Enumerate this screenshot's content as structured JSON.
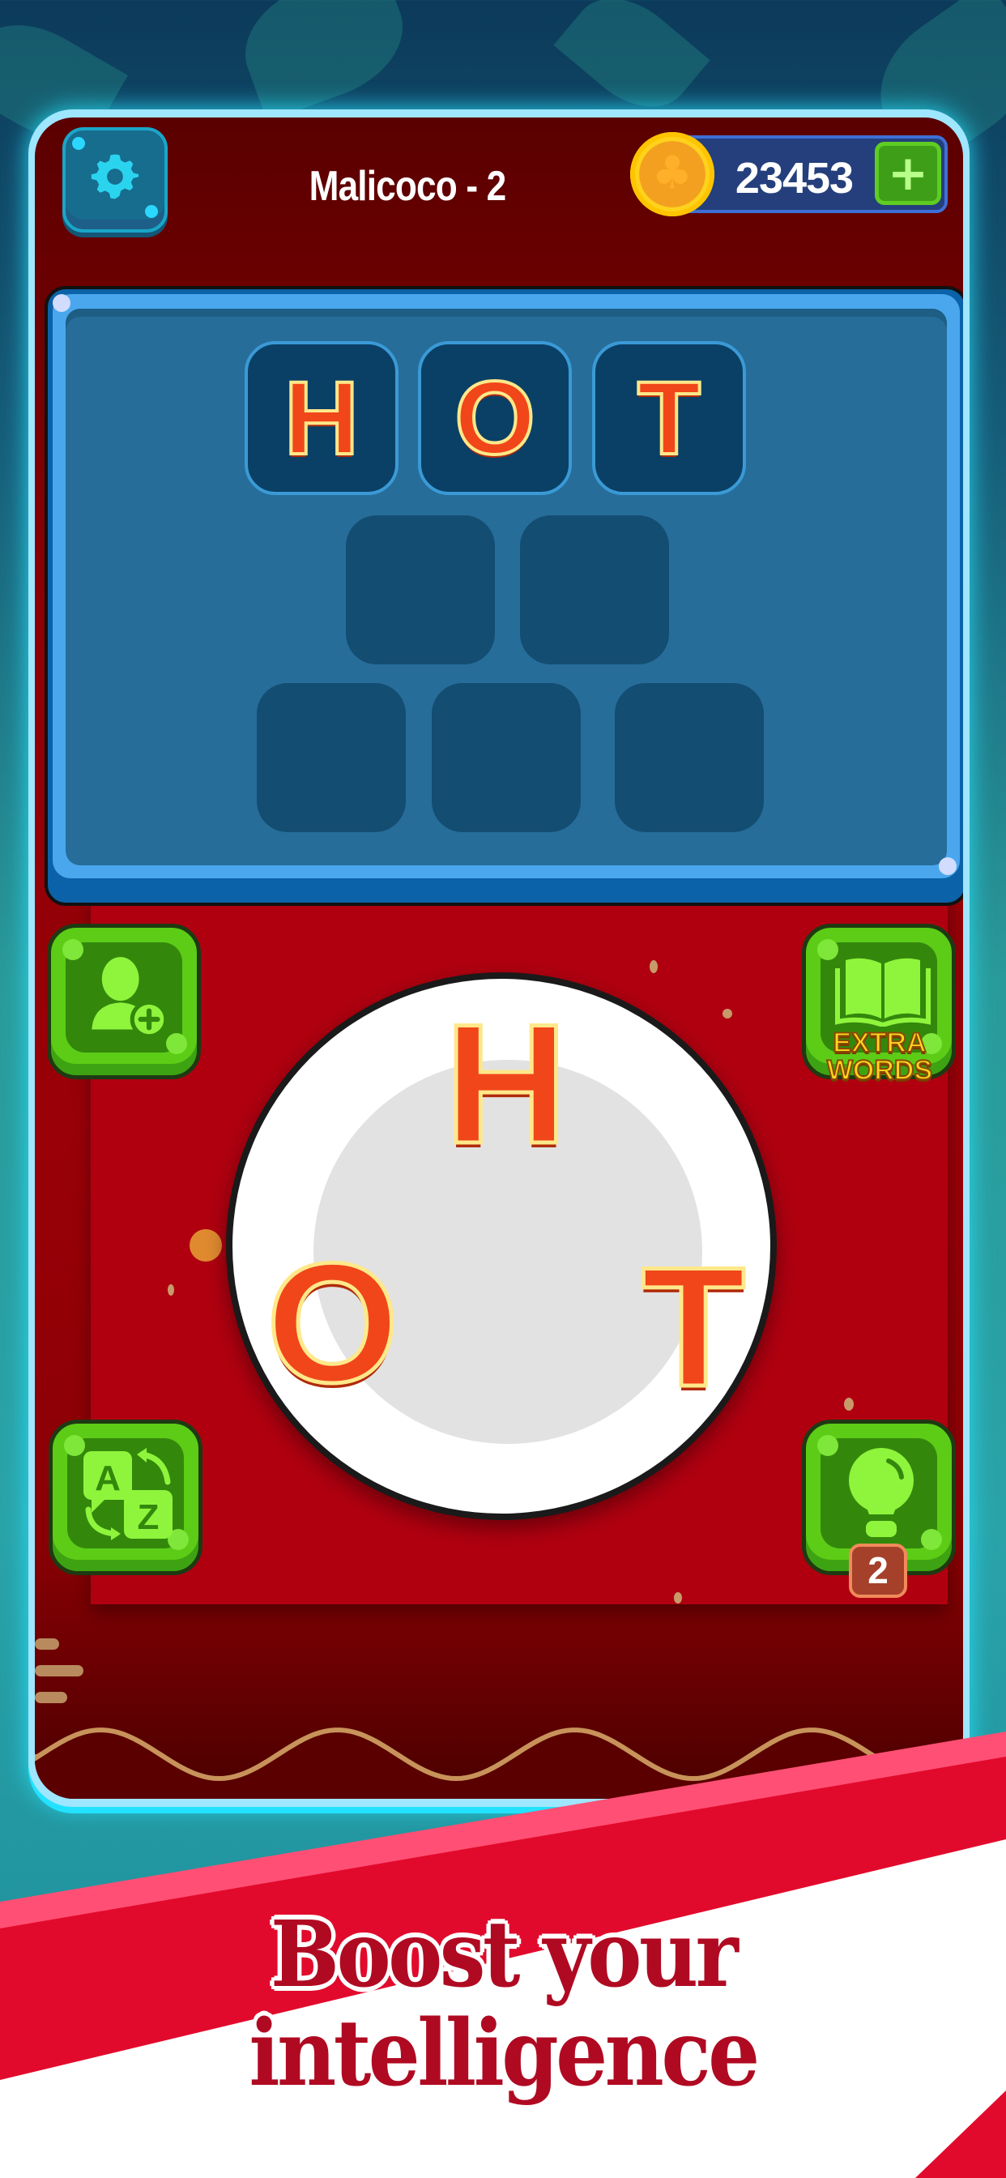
{
  "header": {
    "level_title": "Malicoco - 2",
    "coin_count": "23453",
    "settings_icon": "gear-icon",
    "coin_icon": "club-coin-icon",
    "add_coins_icon": "plus-icon"
  },
  "puzzle": {
    "rows": [
      {
        "slots": [
          {
            "letter": "H",
            "filled": true
          },
          {
            "letter": "O",
            "filled": true
          },
          {
            "letter": "T",
            "filled": true
          }
        ]
      },
      {
        "slots": [
          {
            "letter": "",
            "filled": false
          },
          {
            "letter": "",
            "filled": false
          }
        ]
      },
      {
        "slots": [
          {
            "letter": "",
            "filled": false
          },
          {
            "letter": "",
            "filled": false
          },
          {
            "letter": "",
            "filled": false
          }
        ]
      }
    ]
  },
  "wheel": {
    "letters": [
      "H",
      "O",
      "T"
    ]
  },
  "actions": {
    "invite": {
      "icon": "user-add-icon"
    },
    "extra_words": {
      "icon": "book-icon",
      "label_line1": "EXTRA",
      "label_line2": "WORDS"
    },
    "shuffle": {
      "icon": "shuffle-az-icon",
      "glyph_a": "A",
      "glyph_z": "Z"
    },
    "hint": {
      "icon": "lightbulb-icon",
      "count": "2"
    }
  },
  "banner": {
    "line1": "Boost your",
    "line2": "intelligence"
  },
  "colors": {
    "panel_blue": "#266d9a",
    "tile_empty": "#144d72",
    "letter_orange": "#f0461a",
    "button_green": "#5ccc16",
    "board_red": "#b00010",
    "banner_red": "#e20a2c",
    "banner_pink": "#ff4f74",
    "banner_text": "#b00a22"
  }
}
